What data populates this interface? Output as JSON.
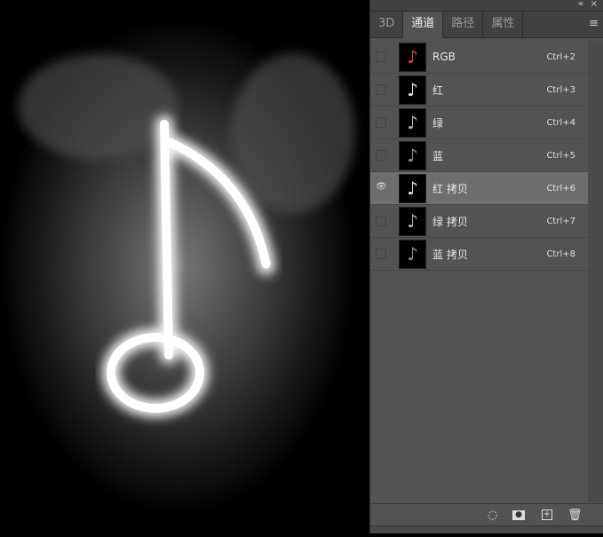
{
  "panel": {
    "tabs": [
      "3D",
      "通道",
      "路径",
      "属性"
    ],
    "active_tab": 1,
    "collapse_icon": "«",
    "close_icon": "×",
    "menu_icon": "≡"
  },
  "channels": [
    {
      "name": "RGB",
      "shortcut": "Ctrl+2",
      "visible": false,
      "selected": false,
      "thumb_color": "#e0401a"
    },
    {
      "name": "红",
      "shortcut": "Ctrl+3",
      "visible": false,
      "selected": false,
      "thumb_color": "#dddddd"
    },
    {
      "name": "绿",
      "shortcut": "Ctrl+4",
      "visible": false,
      "selected": false,
      "thumb_color": "#aaaaaa"
    },
    {
      "name": "蓝",
      "shortcut": "Ctrl+5",
      "visible": false,
      "selected": false,
      "thumb_color": "#888888"
    },
    {
      "name": "红 拷贝",
      "shortcut": "Ctrl+6",
      "visible": true,
      "selected": true,
      "thumb_color": "#dddddd"
    },
    {
      "name": "绿 拷贝",
      "shortcut": "Ctrl+7",
      "visible": false,
      "selected": false,
      "thumb_color": "#aaaaaa"
    },
    {
      "name": "蓝 拷贝",
      "shortcut": "Ctrl+8",
      "visible": false,
      "selected": false,
      "thumb_color": "#888888"
    }
  ],
  "footer_icons": [
    "load-selection-icon",
    "save-selection-icon",
    "new-channel-icon",
    "delete-channel-icon"
  ]
}
